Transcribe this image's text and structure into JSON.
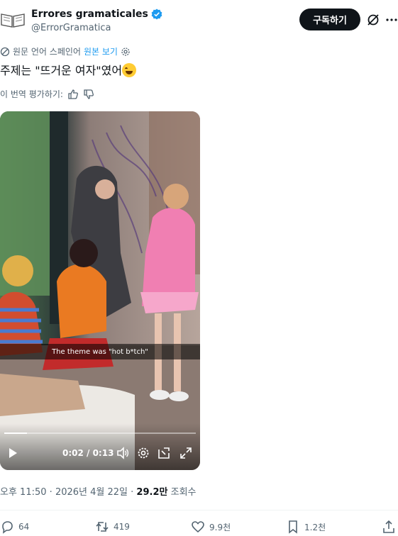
{
  "author": {
    "display_name": "Errores gramaticales",
    "handle": "@ErrorGramatica",
    "avatar_icon": "open-book-icon",
    "verified_color": "#1d9bf0"
  },
  "header": {
    "subscribe_label": "구독하기"
  },
  "translation": {
    "source_label": "원문 언어 스페인어",
    "show_original_label": "원본 보기"
  },
  "tweet": {
    "text": "주제는 \"뜨거운 여자\"였어",
    "emoji_icon": "face-with-tears-of-joy-icon"
  },
  "rate_translation": {
    "label": "이 번역 평가하기:"
  },
  "video": {
    "caption": "The theme was \"hot b*tch\"",
    "current_time": "0:02",
    "duration": "0:13",
    "time_display": "0:02 / 0:13",
    "progress": 0.12
  },
  "meta": {
    "time": "오후 11:50",
    "date": "2026년 4월 22일",
    "separator": "·",
    "views_count": "29.2만",
    "views_label": "조회수"
  },
  "actions": {
    "replies": "64",
    "reposts": "419",
    "likes": "9.9천",
    "bookmarks": "1.2천"
  }
}
